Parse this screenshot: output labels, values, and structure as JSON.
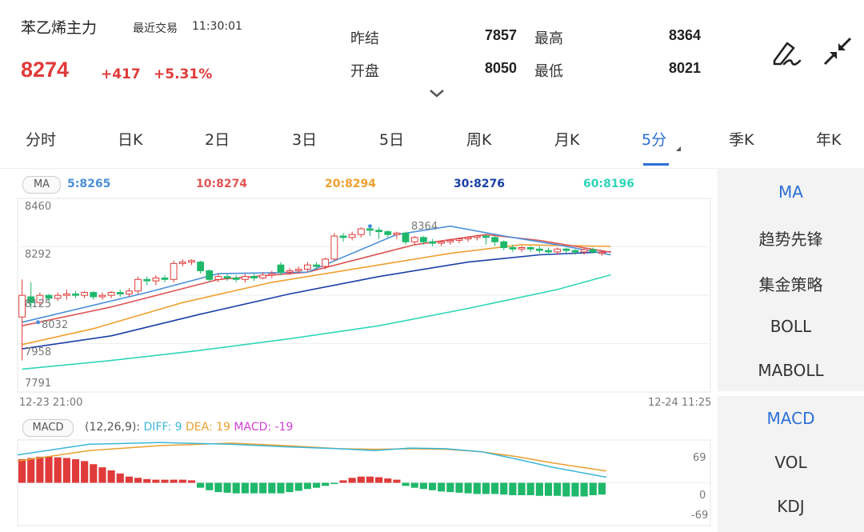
{
  "header": {
    "title": "苯乙烯主力",
    "last_trade_label": "最近交易",
    "last_trade_time": "11:30:01",
    "price": "8274",
    "change": "+417",
    "change_pct": "+5.31%",
    "quote": [
      {
        "label": "昨结",
        "value": "7857"
      },
      {
        "label": "最高",
        "value": "8364"
      },
      {
        "label": "开盘",
        "value": "8050"
      },
      {
        "label": "最低",
        "value": "8021"
      }
    ],
    "expand_icon": "chevron-down-icon",
    "draw_icon": "pen-draw-icon",
    "shrink_icon": "collapse-arrows-icon"
  },
  "tabs": [
    {
      "label": "分时"
    },
    {
      "label": "日K"
    },
    {
      "label": "2日"
    },
    {
      "label": "3日"
    },
    {
      "label": "5日"
    },
    {
      "label": "周K"
    },
    {
      "label": "月K"
    },
    {
      "label": "5分"
    },
    {
      "label": "季K"
    },
    {
      "label": "年K"
    }
  ],
  "active_tab": "5分",
  "ma_legend": {
    "badge": "MA",
    "ma5": "5:8265",
    "ma10": "10:8274",
    "ma20": "20:8294",
    "ma30": "30:8276",
    "ma60": "60:8196"
  },
  "price_axis": [
    "8460",
    "8292",
    "8125",
    "7958",
    "7791"
  ],
  "time_axis": {
    "start": "12-23 21:00",
    "end": "12-24 11:25"
  },
  "annotations": {
    "high": "8364",
    "low": "8032"
  },
  "macd_legend": {
    "badge": "MACD",
    "params": "(12,26,9):",
    "diff": "DIFF: 9",
    "dea": "DEA: 19",
    "macd": "MACD: -19"
  },
  "macd_axis": [
    "69",
    "0",
    "-69"
  ],
  "side_panel_main": [
    {
      "label": "MA"
    },
    {
      "label": "趋势先锋"
    },
    {
      "label": "集金策略"
    },
    {
      "label": "BOLL"
    },
    {
      "label": "MABOLL"
    }
  ],
  "side_panel_sub": [
    {
      "label": "MACD"
    },
    {
      "label": "VOL"
    },
    {
      "label": "KDJ"
    }
  ],
  "colors": {
    "up": "#e03a3a",
    "down": "#1fb86b",
    "accent": "#2b6fd6",
    "ma5": "#4a90d9",
    "ma10": "#e05555",
    "ma20": "#f0a030",
    "ma30": "#1a3fa8",
    "ma60": "#2fd6b8",
    "diff": "#3cb7d8",
    "dea": "#e8a030",
    "macd_label": "#d040d0"
  },
  "chart_data": {
    "type": "candlestick",
    "y_range": [
      7791,
      8460
    ],
    "candles": [
      [
        8050,
        8125,
        7900,
        8180
      ],
      [
        8120,
        8100,
        8080,
        8170
      ],
      [
        8100,
        8125,
        8090,
        8135
      ],
      [
        8125,
        8115,
        8100,
        8130
      ],
      [
        8115,
        8125,
        8105,
        8135
      ],
      [
        8125,
        8130,
        8110,
        8145
      ],
      [
        8130,
        8125,
        8115,
        8140
      ],
      [
        8125,
        8135,
        8115,
        8140
      ],
      [
        8135,
        8120,
        8110,
        8140
      ],
      [
        8120,
        8125,
        8110,
        8135
      ],
      [
        8125,
        8135,
        8115,
        8140
      ],
      [
        8135,
        8130,
        8120,
        8145
      ],
      [
        8130,
        8140,
        8120,
        8150
      ],
      [
        8140,
        8180,
        8130,
        8190
      ],
      [
        8180,
        8175,
        8160,
        8190
      ],
      [
        8175,
        8185,
        8160,
        8195
      ],
      [
        8185,
        8180,
        8170,
        8195
      ],
      [
        8180,
        8235,
        8170,
        8245
      ],
      [
        8235,
        8240,
        8225,
        8250
      ],
      [
        8240,
        8245,
        8230,
        8250
      ],
      [
        8240,
        8210,
        8200,
        8245
      ],
      [
        8210,
        8180,
        8170,
        8215
      ],
      [
        8180,
        8190,
        8170,
        8200
      ],
      [
        8190,
        8185,
        8175,
        8200
      ],
      [
        8185,
        8180,
        8170,
        8195
      ],
      [
        8180,
        8190,
        8170,
        8200
      ],
      [
        8190,
        8185,
        8175,
        8200
      ],
      [
        8185,
        8195,
        8180,
        8205
      ],
      [
        8195,
        8200,
        8185,
        8210
      ],
      [
        8230,
        8205,
        8195,
        8240
      ],
      [
        8205,
        8210,
        8195,
        8220
      ],
      [
        8210,
        8215,
        8200,
        8225
      ],
      [
        8215,
        8230,
        8205,
        8240
      ],
      [
        8230,
        8225,
        8215,
        8240
      ],
      [
        8225,
        8250,
        8215,
        8255
      ],
      [
        8250,
        8330,
        8245,
        8340
      ],
      [
        8330,
        8325,
        8310,
        8340
      ],
      [
        8325,
        8335,
        8315,
        8345
      ],
      [
        8335,
        8355,
        8325,
        8360
      ],
      [
        8355,
        8350,
        8330,
        8364
      ],
      [
        8350,
        8345,
        8320,
        8360
      ],
      [
        8345,
        8335,
        8325,
        8350
      ],
      [
        8335,
        8340,
        8320,
        8345
      ],
      [
        8340,
        8310,
        8300,
        8345
      ],
      [
        8310,
        8325,
        8300,
        8330
      ],
      [
        8325,
        8310,
        8300,
        8330
      ],
      [
        8310,
        8305,
        8295,
        8320
      ],
      [
        8305,
        8310,
        8295,
        8315
      ],
      [
        8310,
        8315,
        8300,
        8320
      ],
      [
        8315,
        8320,
        8305,
        8325
      ],
      [
        8320,
        8325,
        8310,
        8330
      ],
      [
        8325,
        8330,
        8315,
        8335
      ],
      [
        8330,
        8325,
        8300,
        8335
      ],
      [
        8325,
        8310,
        8295,
        8330
      ],
      [
        8310,
        8290,
        8280,
        8315
      ],
      [
        8290,
        8285,
        8275,
        8300
      ],
      [
        8285,
        8290,
        8275,
        8295
      ],
      [
        8290,
        8285,
        8275,
        8295
      ],
      [
        8285,
        8280,
        8270,
        8295
      ],
      [
        8280,
        8275,
        8265,
        8290
      ],
      [
        8275,
        8285,
        8265,
        8290
      ],
      [
        8285,
        8280,
        8270,
        8290
      ],
      [
        8280,
        8275,
        8265,
        8285
      ],
      [
        8275,
        8283,
        8265,
        8287
      ],
      [
        8283,
        8275,
        8270,
        8290
      ],
      [
        8270,
        8274,
        8262,
        8282
      ]
    ],
    "ma": {
      "ma5": [
        [
          0,
          8032
        ],
        [
          14,
          8135
        ],
        [
          22,
          8200
        ],
        [
          32,
          8205
        ],
        [
          42,
          8335
        ],
        [
          48,
          8364
        ],
        [
          54,
          8330
        ],
        [
          60,
          8300
        ],
        [
          66,
          8265
        ]
      ],
      "ma10": [
        [
          0,
          8020
        ],
        [
          10,
          8085
        ],
        [
          22,
          8180
        ],
        [
          32,
          8205
        ],
        [
          44,
          8300
        ],
        [
          52,
          8335
        ],
        [
          58,
          8315
        ],
        [
          66,
          8274
        ]
      ],
      "ma20": [
        [
          0,
          7955
        ],
        [
          8,
          8010
        ],
        [
          18,
          8100
        ],
        [
          28,
          8170
        ],
        [
          38,
          8220
        ],
        [
          48,
          8270
        ],
        [
          56,
          8300
        ],
        [
          66,
          8294
        ]
      ],
      "ma30": [
        [
          0,
          7940
        ],
        [
          10,
          7985
        ],
        [
          20,
          8060
        ],
        [
          30,
          8130
        ],
        [
          40,
          8190
        ],
        [
          50,
          8240
        ],
        [
          58,
          8265
        ],
        [
          66,
          8276
        ]
      ],
      "ma60": [
        [
          0,
          7870
        ],
        [
          10,
          7900
        ],
        [
          20,
          7935
        ],
        [
          30,
          7975
        ],
        [
          40,
          8020
        ],
        [
          50,
          8080
        ],
        [
          60,
          8145
        ],
        [
          66,
          8196
        ]
      ]
    },
    "macd_range": [
      -69,
      69
    ],
    "macd_hist": [
      38,
      40,
      42,
      42,
      41,
      40,
      38,
      35,
      30,
      25,
      20,
      15,
      10,
      8,
      6,
      5,
      5,
      5,
      5,
      4,
      -8,
      -12,
      -15,
      -16,
      -17,
      -17,
      -17,
      -17,
      -17,
      -17,
      -15,
      -13,
      -10,
      -8,
      -5,
      -2,
      4,
      8,
      10,
      10,
      9,
      7,
      5,
      -5,
      -8,
      -10,
      -12,
      -14,
      -15,
      -16,
      -17,
      -18,
      -18,
      -18,
      -19,
      -20,
      -20,
      -20,
      -21,
      -21,
      -21,
      -22,
      -22,
      -22,
      -20,
      -19
    ],
    "diff_line": [
      [
        0,
        45
      ],
      [
        8,
        62
      ],
      [
        16,
        65
      ],
      [
        24,
        62
      ],
      [
        30,
        58
      ],
      [
        36,
        55
      ],
      [
        40,
        52
      ],
      [
        44,
        56
      ],
      [
        48,
        55
      ],
      [
        52,
        50
      ],
      [
        56,
        38
      ],
      [
        60,
        25
      ],
      [
        66,
        9
      ]
    ],
    "dea_line": [
      [
        0,
        35
      ],
      [
        8,
        52
      ],
      [
        16,
        60
      ],
      [
        24,
        64
      ],
      [
        30,
        60
      ],
      [
        36,
        55
      ],
      [
        40,
        54
      ],
      [
        44,
        55
      ],
      [
        48,
        54
      ],
      [
        52,
        50
      ],
      [
        56,
        42
      ],
      [
        60,
        32
      ],
      [
        66,
        19
      ]
    ]
  }
}
